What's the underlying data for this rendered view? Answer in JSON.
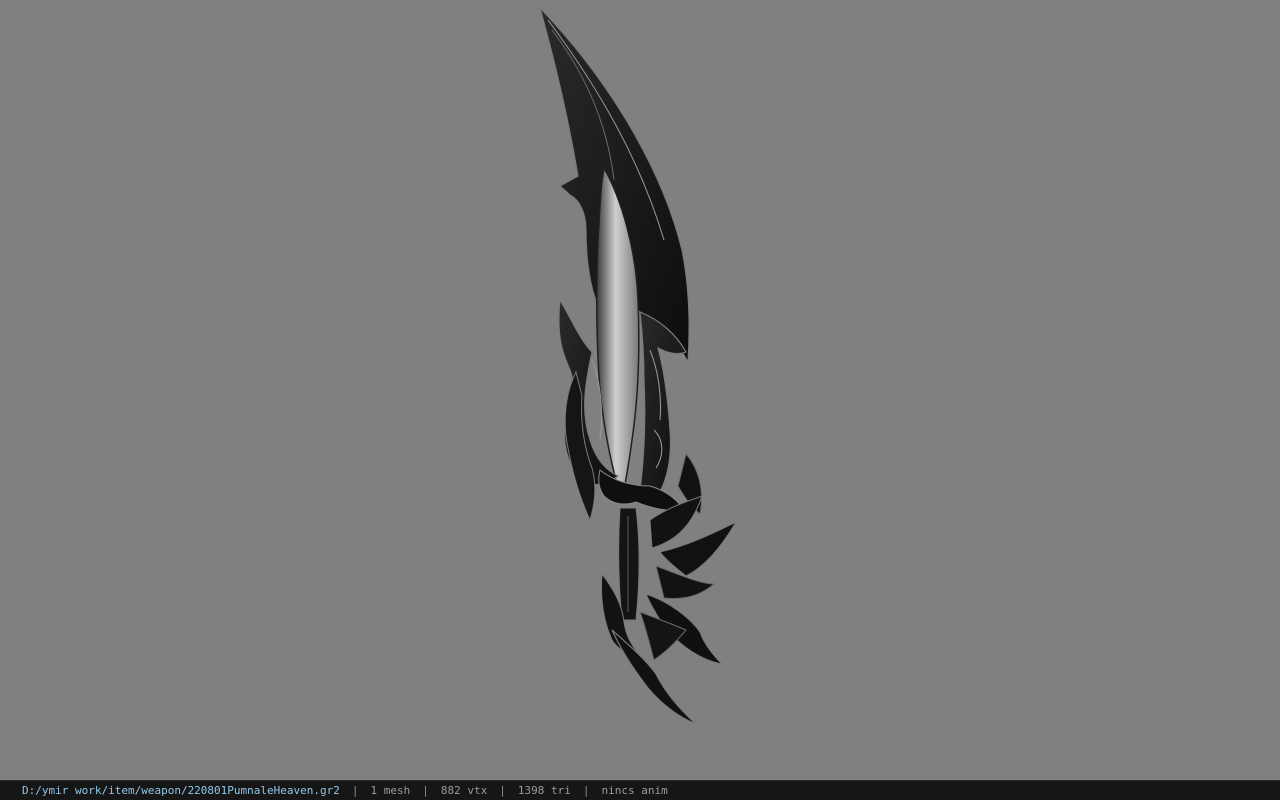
{
  "model": {
    "icon": "dagger-model-icon",
    "colors": {
      "background": "#808080",
      "metal_dark": "#141414",
      "metal_edge": "#8a8a8a",
      "blade_core": "#bdbdbd"
    }
  },
  "status_bar": {
    "file_path": "D:/ymir work/item/weapon/220801PumnaleHeaven.gr2",
    "separator": "|",
    "mesh_count": "1 mesh",
    "vertex_count": "882 vtx",
    "triangle_count": "1398 tri",
    "animation": "nincs anim",
    "colors": {
      "background": "#161616",
      "path": "#8fc8e8",
      "text": "#9a9a9a"
    }
  }
}
